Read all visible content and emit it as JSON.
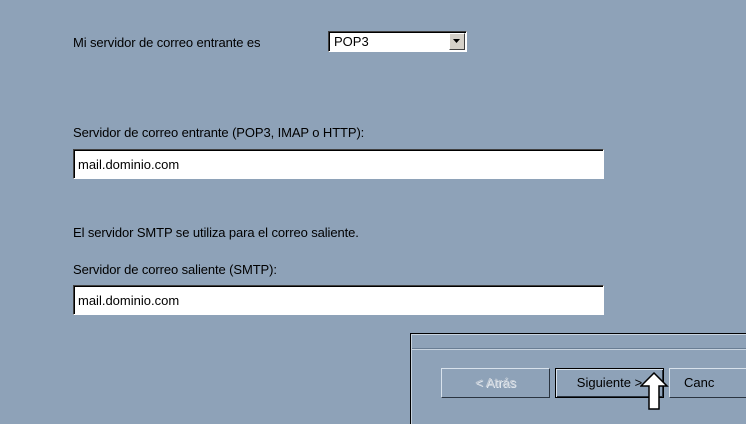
{
  "incoming": {
    "type_label": "Mi servidor de correo entrante es",
    "type_value": "POP3",
    "server_label": "Servidor de correo entrante (POP3, IMAP o HTTP):",
    "server_value": "mail.dominio.com"
  },
  "outgoing": {
    "info_text": "El servidor SMTP se utiliza para el correo saliente.",
    "server_label": "Servidor de correo saliente (SMTP):",
    "server_value": "mail.dominio.com"
  },
  "buttons": {
    "back_label": "< Atrás",
    "next_label": "Siguiente >",
    "cancel_label": "Canc"
  },
  "icons": {
    "combo_arrow": "chevron-down-icon",
    "cursor": "mouse-pointer-icon"
  },
  "colors": {
    "background": "#8ea2b8",
    "field": "#ffffff"
  }
}
